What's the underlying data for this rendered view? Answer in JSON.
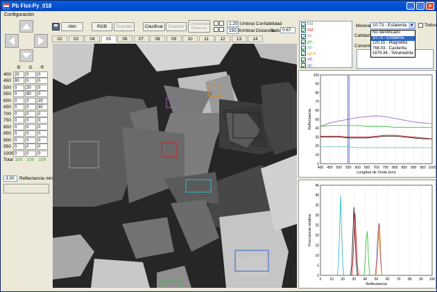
{
  "window": {
    "title": "Pb Flot-Py_018",
    "menu": [
      "Configuración"
    ]
  },
  "toolbar": {
    "abrir": "Abri",
    "rgb": "RGB",
    "guardar1": "Guardar",
    "clasificar": "Clasificar",
    "guardar2": "Guardar",
    "confiabilidad_btn": "Confiabilidad Distancia",
    "umbral_conf_value": "1.20",
    "umbral_conf_label": "Umbral Confiabilidad",
    "umbral_dist_value": "150.0",
    "umbral_dist_label": "Umbral Distancia",
    "ratio_label": "Ratio",
    "ratio_value": "0.67"
  },
  "tabs": [
    "02",
    "03",
    "04",
    "05",
    "06",
    "07",
    "08",
    "09",
    "10",
    "11",
    "12",
    "13",
    "14"
  ],
  "selected_tab": "05",
  "band_table": {
    "headers": [
      "B",
      "G",
      "R"
    ],
    "rows": [
      {
        "w": "400",
        "b": "20",
        "g": "0",
        "r": "0"
      },
      {
        "w": "450",
        "b": "80",
        "g": "0",
        "r": "0"
      },
      {
        "w": "500",
        "b": "0",
        "g": "20",
        "r": "0"
      },
      {
        "w": "550",
        "b": "0",
        "g": "80",
        "r": "0"
      },
      {
        "w": "600",
        "b": "0",
        "g": "0",
        "r": "20"
      },
      {
        "w": "650",
        "b": "0",
        "g": "0",
        "r": "80"
      },
      {
        "w": "700",
        "b": "0",
        "g": "0",
        "r": "0"
      },
      {
        "w": "750",
        "b": "0",
        "g": "0",
        "r": "0"
      },
      {
        "w": "800",
        "b": "0",
        "g": "0",
        "r": "0"
      },
      {
        "w": "850",
        "b": "0",
        "g": "0",
        "r": "0"
      },
      {
        "w": "900",
        "b": "0",
        "g": "0",
        "r": "0"
      },
      {
        "w": "950",
        "b": "0",
        "g": "0",
        "r": "0"
      },
      {
        "w": "1000",
        "b": "0",
        "g": "0",
        "r": "0"
      }
    ],
    "total_label": "Total",
    "totals": {
      "b": "100",
      "g": "100",
      "r": "100"
    }
  },
  "reflectancia_min": {
    "value": "3.00",
    "label": "Reflectancia min"
  },
  "legend": [
    {
      "label": "thd -",
      "color": "#7a7a7a"
    },
    {
      "label": "thd -",
      "color": "#cc3333"
    },
    {
      "label": "py -",
      "color": "#b07a9a"
    },
    {
      "label": "gn -",
      "color": "#33aa33"
    },
    {
      "label": "sp -",
      "color": "#33aaaa"
    },
    {
      "label": "cp-A",
      "color": "#dd8822"
    },
    {
      "label": "sd -",
      "color": "#aa33aa"
    },
    {
      "label": "sp -",
      "color": "#3366cc"
    }
  ],
  "mineral": {
    "label": "Mineral",
    "selected": "10.73 - Esfalerita",
    "options": [
      "No identificado",
      "10.73 - Esfalerita",
      "220.15 - Magnetita",
      "768.03 - Casiterita",
      "1679.38 - Tetrahedrita"
    ],
    "highlight_index": 1,
    "todos_label": "Todos",
    "calidad_label": "Calidad",
    "comentario_label": "Comentario"
  },
  "chart_data": [
    {
      "type": "line",
      "xlabel": "Longitud de Onda (nm)",
      "ylabel": "Reflectancia",
      "xlim": [
        400,
        1000
      ],
      "ylim": [
        0,
        100
      ],
      "xticks": [
        400,
        450,
        500,
        550,
        600,
        650,
        700,
        750,
        800,
        850,
        900,
        950,
        1000
      ],
      "yticks": [
        0,
        10,
        20,
        30,
        40,
        50,
        60,
        70,
        80,
        90,
        100
      ],
      "marker_x": [
        550
      ],
      "series": [
        {
          "color": "#9a6ac0",
          "x": [
            400,
            450,
            500,
            550,
            600,
            650,
            700,
            750,
            800,
            850,
            900,
            950,
            1000
          ],
          "values": [
            42,
            46,
            48,
            50,
            52,
            53,
            54,
            53,
            51,
            49,
            47,
            46,
            45
          ]
        },
        {
          "color": "#44bb44",
          "x": [
            400,
            450,
            500,
            550,
            600,
            650,
            700,
            750,
            800,
            850,
            900,
            950,
            1000
          ],
          "values": [
            42,
            43,
            43,
            43,
            43,
            42,
            42,
            42,
            41,
            41,
            41,
            41,
            41
          ]
        },
        {
          "color": "#cc2222",
          "x": [
            400,
            450,
            500,
            550,
            600,
            650,
            700,
            750,
            800,
            850,
            900,
            950,
            1000
          ],
          "values": [
            31,
            31,
            31,
            30,
            30,
            30,
            31,
            32,
            32,
            31,
            30,
            29,
            28
          ]
        },
        {
          "color": "#222222",
          "x": [
            400,
            450,
            500,
            550,
            600,
            650,
            700,
            750,
            800,
            850,
            900,
            950,
            1000
          ],
          "values": [
            30,
            30,
            30,
            29,
            29,
            29,
            30,
            31,
            31,
            30,
            29,
            28,
            28
          ]
        },
        {
          "color": "#66c0d0",
          "x": [
            400,
            450,
            500,
            550,
            600,
            650,
            700,
            750,
            800,
            850,
            900,
            950,
            1000
          ],
          "values": [
            19,
            19,
            19,
            19,
            18,
            18,
            18,
            18,
            18,
            18,
            18,
            18,
            18
          ]
        }
      ]
    },
    {
      "type": "line",
      "xlabel": "Reflectancia",
      "ylabel": "Frecuencia relativa",
      "xlim": [
        0,
        100
      ],
      "ylim": [
        0,
        45
      ],
      "xticks": [
        0,
        10,
        20,
        30,
        40,
        50,
        60,
        70,
        80,
        90,
        100
      ],
      "yticks": [
        0,
        5,
        10,
        15,
        20,
        25,
        30,
        35,
        40,
        45
      ],
      "series": [
        {
          "color": "#33bbcc",
          "x": [
            15,
            16,
            17,
            18,
            19,
            20,
            21
          ],
          "values": [
            0,
            5,
            20,
            40,
            20,
            5,
            0
          ]
        },
        {
          "color": "#222222",
          "x": [
            27,
            28,
            29,
            30,
            31,
            32,
            33
          ],
          "values": [
            0,
            6,
            20,
            34,
            20,
            6,
            0
          ]
        },
        {
          "color": "#cc2222",
          "x": [
            28,
            29,
            30,
            31,
            32,
            33,
            34
          ],
          "values": [
            0,
            6,
            18,
            31,
            18,
            6,
            0
          ]
        },
        {
          "color": "#44bb44",
          "x": [
            39,
            40,
            41,
            42,
            43,
            44
          ],
          "values": [
            0,
            7,
            18,
            22,
            8,
            0
          ]
        },
        {
          "color": "#9a6ac0",
          "x": [
            49,
            50,
            51,
            52,
            53,
            54,
            55
          ],
          "values": [
            0,
            6,
            16,
            26,
            16,
            6,
            0
          ]
        },
        {
          "color": "#dd8822",
          "x": [
            50,
            51,
            52,
            53,
            54,
            55
          ],
          "values": [
            0,
            8,
            22,
            26,
            10,
            0
          ]
        }
      ]
    }
  ],
  "colors": {
    "titlebar": "#0a5fd8",
    "window_bg": "#ece9d8"
  }
}
